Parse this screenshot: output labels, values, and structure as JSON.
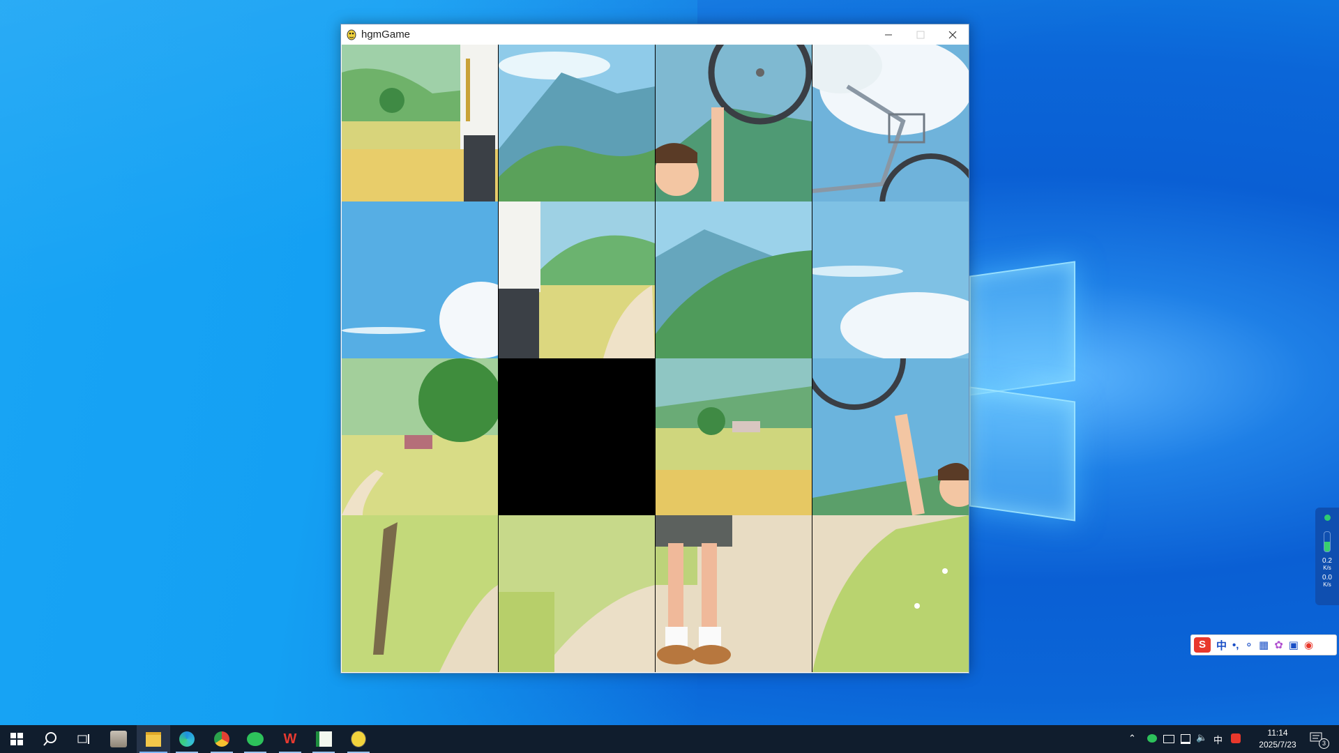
{
  "window": {
    "title": "hgmGame",
    "icon": "pygame-snake-icon",
    "controls": [
      "minimize-icon",
      "maximize-icon",
      "close-icon"
    ]
  },
  "puzzle": {
    "grid": "4x4",
    "blank_position": {
      "row": 3,
      "col": 2
    }
  },
  "network_widget": {
    "upload": "0.2",
    "upload_unit": "K/s",
    "download": "0.0",
    "download_unit": "K/s"
  },
  "ime": {
    "mode": "中",
    "punct": "•,"
  },
  "taskbar": {
    "items": [
      "start-icon",
      "search-icon",
      "task-view-icon",
      "photo-app-icon",
      "file-explorer-icon",
      "edge-icon",
      "chrome-icon",
      "wechat-icon",
      "wps-icon",
      "spreadsheet-icon",
      "pygame-icon"
    ]
  },
  "tray": {
    "lang": "中",
    "time": "11:14",
    "date": "2025/7/23",
    "notifications": "3"
  },
  "colors": {
    "desktop": "#1aa0f2",
    "taskbar": "#101d2d",
    "tile_blank": "#000000"
  }
}
